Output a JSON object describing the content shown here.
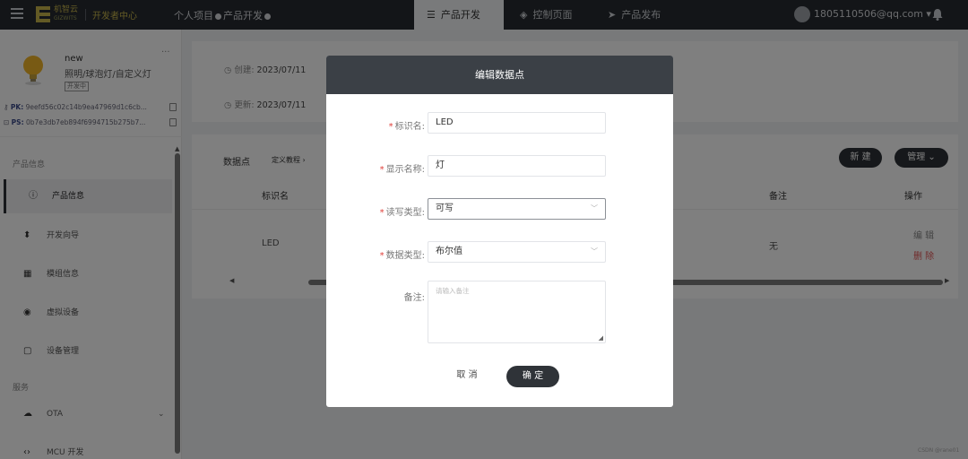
{
  "topbar": {
    "logo_cn": "机智云",
    "logo_en": "GIZWITS",
    "dev_center": "开发者中心",
    "crumb_personal": "个人项目",
    "crumb_product_dev": "产品开发",
    "tabs": [
      {
        "label": "产品开发",
        "icon": "sliders-icon",
        "active": true
      },
      {
        "label": "控制页面",
        "icon": "diamond-icon",
        "active": false
      },
      {
        "label": "产品发布",
        "icon": "send-icon",
        "active": false
      }
    ],
    "user_email": "1805110506@qq.com ▾"
  },
  "sidebar": {
    "product_name": "new",
    "product_type": "照明/球泡灯/自定义灯",
    "product_status": "开发中",
    "pk_label": "PK:",
    "pk_value": "9eefd56c02c14b9ea47969d1c6cb...",
    "ps_label": "PS:",
    "ps_value": "0b7e3db7eb894f6994715b275b7...",
    "section_product": "产品信息",
    "items": [
      {
        "label": "产品信息",
        "icon": "info-icon",
        "glyph": "ⓘ",
        "active": true
      },
      {
        "label": "开发向导",
        "icon": "pin-icon",
        "glyph": "⬍",
        "active": false
      },
      {
        "label": "模组信息",
        "icon": "module-icon",
        "glyph": "▦",
        "active": false
      },
      {
        "label": "虚拟设备",
        "icon": "virtual-device-icon",
        "glyph": "◉",
        "active": false
      },
      {
        "label": "设备管理",
        "icon": "device-manage-icon",
        "glyph": "▢",
        "active": false
      }
    ],
    "section_service": "服务",
    "service_items": [
      {
        "label": "OTA",
        "icon": "cloud-icon",
        "glyph": "☁"
      },
      {
        "label": "MCU 开发",
        "icon": "code-icon",
        "glyph": "‹›"
      }
    ]
  },
  "info": {
    "created_label": "创建:",
    "created_value": "2023/07/11",
    "updated_label": "更新:",
    "updated_value": "2023/07/11"
  },
  "datapoints": {
    "title": "数据点",
    "tutorial_link": "定义教程 ›",
    "new_button": "新 建",
    "manage_button": "管理 ⌄",
    "columns": {
      "id_name": "标识名",
      "note": "备注",
      "action": "操作"
    },
    "rows": [
      {
        "id_name": "LED",
        "note": "无",
        "edit": "编 辑",
        "delete": "删 除"
      }
    ]
  },
  "modal": {
    "title": "编辑数据点",
    "id_label": "标识名:",
    "id_value": "LED",
    "display_label": "显示名称:",
    "display_value": "灯",
    "rw_label": "读写类型:",
    "rw_value": "可写",
    "dtype_label": "数据类型:",
    "dtype_value": "布尔值",
    "note_label": "备注:",
    "note_placeholder": "请输入备注",
    "cancel": "取 消",
    "confirm": "确 定"
  },
  "watermark": "CSDN @rane01"
}
